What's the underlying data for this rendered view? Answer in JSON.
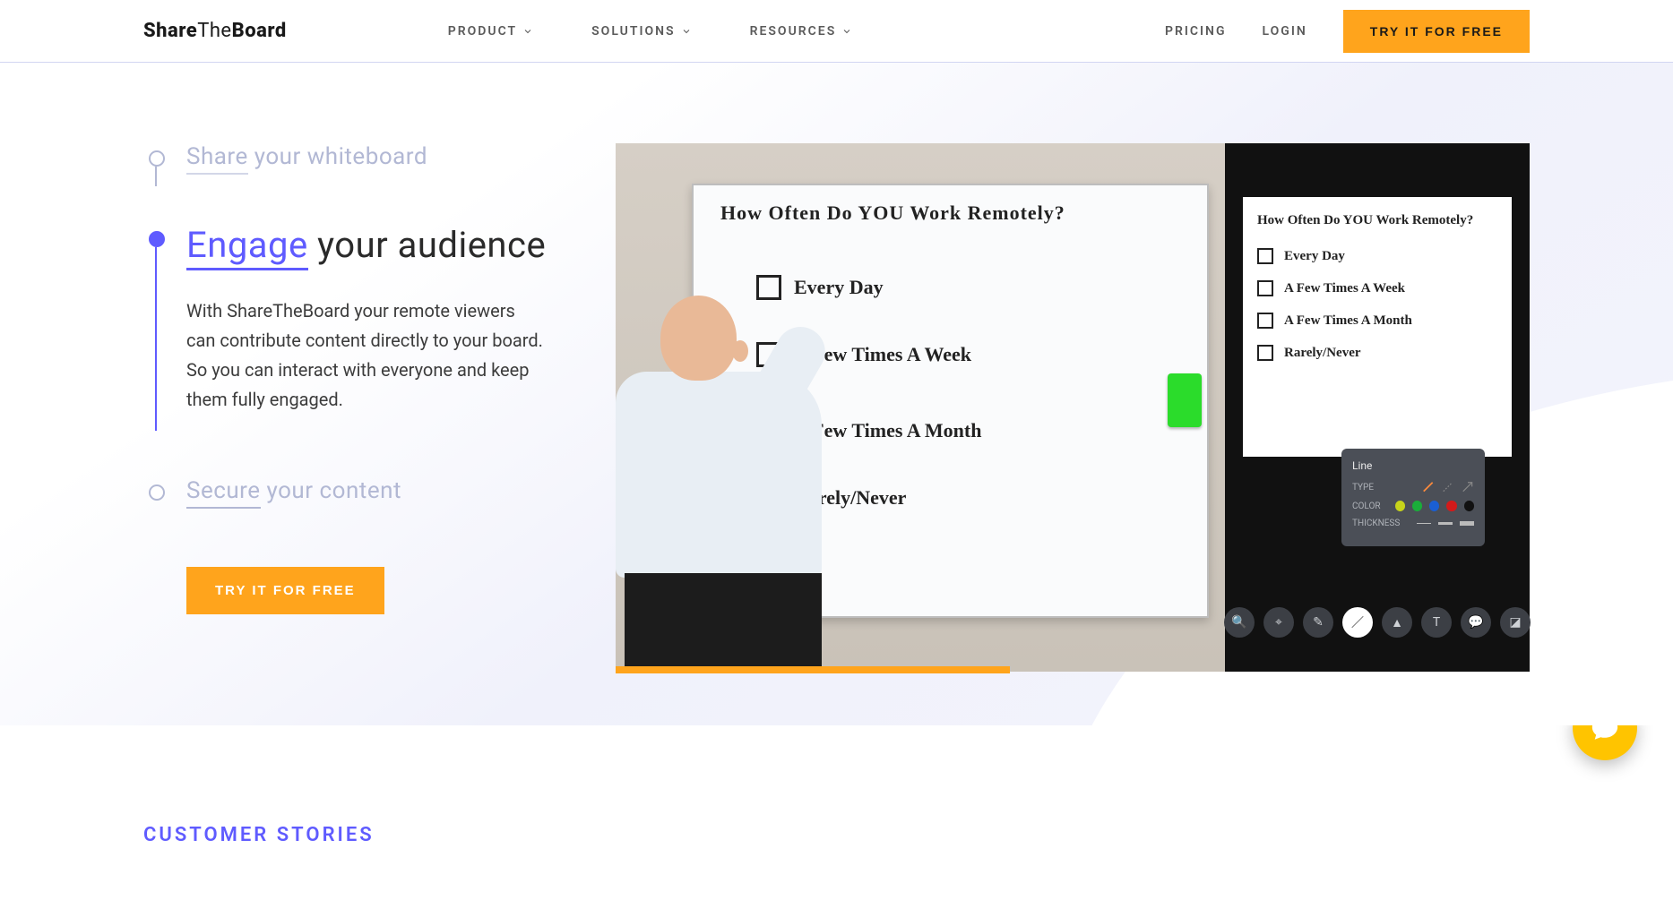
{
  "brand": {
    "part1": "Share",
    "part2": "The",
    "part3": "Board"
  },
  "nav": {
    "product": "PRODUCT",
    "solutions": "SOLUTIONS",
    "resources": "RESOURCES",
    "pricing": "PRICING",
    "login": "LOGIN",
    "cta": "TRY IT FOR FREE"
  },
  "timeline": {
    "share": {
      "accent": "Share",
      "rest": " your whiteboard"
    },
    "engage": {
      "accent": "Engage",
      "rest": " your audience",
      "body": "With ShareTheBoard your remote viewers can contribute content directly to your board. So you can interact with everyone and keep them fully engaged."
    },
    "secure": {
      "accent": "Secure",
      "rest": " your content"
    },
    "cta": "TRY IT FOR FREE"
  },
  "whiteboard": {
    "question": "How Often Do YOU Work Remotely?",
    "options": [
      "Every Day",
      "A Few Times A Week",
      "A Few Times A Month",
      "Rarely/Never"
    ]
  },
  "app_panel": {
    "question": "How Often Do YOU Work Remotely?",
    "options": [
      "Every Day",
      "A Few Times A Week",
      "A Few Times A Month",
      "Rarely/Never"
    ],
    "popover": {
      "title": "Line",
      "type_label": "TYPE",
      "color_label": "COLOR",
      "thickness_label": "THICKNESS"
    }
  },
  "stories": {
    "title": "CUSTOMER STORIES"
  }
}
